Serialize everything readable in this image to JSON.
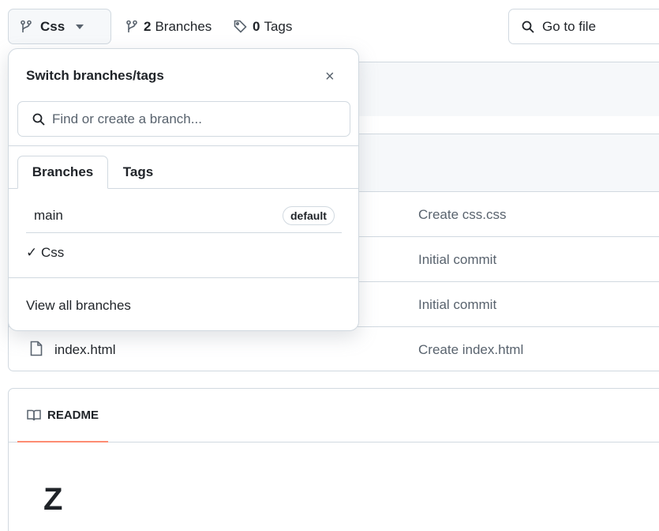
{
  "toolbar": {
    "branch_label": "Css",
    "branches_count": "2",
    "branches_label": "Branches",
    "tags_count": "0",
    "tags_label": "Tags",
    "goto_placeholder": "Go to file"
  },
  "files": [
    {
      "name": "",
      "commit": "Create css.css"
    },
    {
      "name": "",
      "commit": "Initial commit"
    },
    {
      "name": "",
      "commit": "Initial commit"
    },
    {
      "name": "index.html",
      "commit": "Create index.html"
    }
  ],
  "readme": {
    "tab_label": "README",
    "heading": "Z"
  },
  "popup": {
    "title": "Switch branches/tags",
    "close": "×",
    "search_placeholder": "Find or create a branch...",
    "tabs": [
      "Branches",
      "Tags"
    ],
    "branches": [
      {
        "name": "main",
        "badge": "default"
      },
      {
        "name": "✓ Css"
      }
    ],
    "view_all": "View all branches"
  },
  "colors": {
    "border": "#d1d9e0",
    "muted_text": "#59636e",
    "readme_underline": "#fd8c73"
  }
}
